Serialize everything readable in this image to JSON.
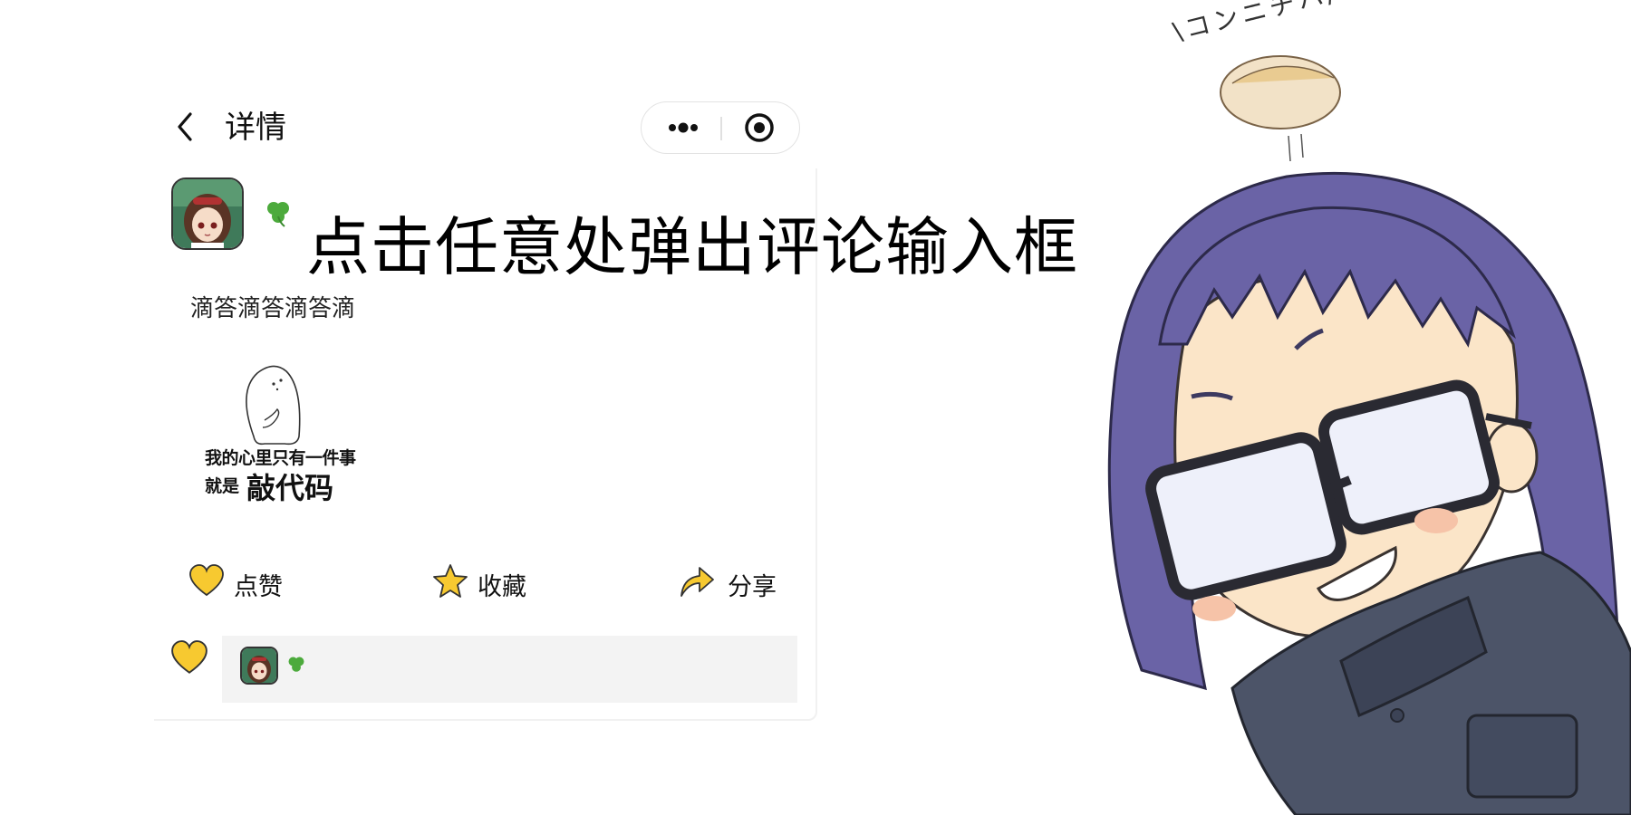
{
  "nav": {
    "title": "详情"
  },
  "post": {
    "overlay_hint": "点击任意处弹出评论输入框",
    "text": "滴答滴答滴答滴",
    "meme_caption_line1": "我的心里只有一件事",
    "meme_caption_line2a": "就是",
    "meme_caption_line2b": "敲代码"
  },
  "actions": {
    "like_label": "点赞",
    "favorite_label": "收藏",
    "share_label": "分享"
  },
  "mascot": {
    "bubble_text": "\\コンニチハ/"
  },
  "colors": {
    "accent_yellow": "#f7c930",
    "likes_bg": "#f3f3f3"
  }
}
